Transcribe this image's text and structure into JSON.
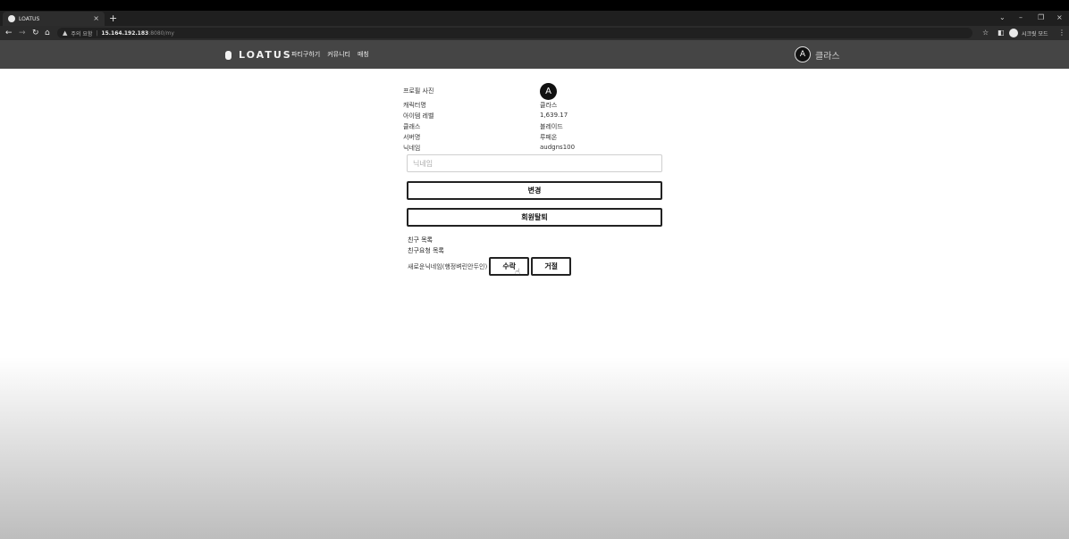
{
  "browser": {
    "tab_title": "LOATUS",
    "tab_close": "×",
    "new_tab": "+",
    "url_warning": "주의 요함",
    "url_host": "15.164.192.183",
    "url_rest": ":8080/my",
    "profile_label": "시크릿 모드",
    "win_minimize": "–",
    "win_restore": "❐",
    "win_close": "×",
    "win_dropdown": "⌄"
  },
  "site": {
    "logo_text": "LOATUS",
    "nav": [
      "파티구하기",
      "커뮤니티",
      "매칭"
    ],
    "header_user_name": "클라스",
    "avatar_glyph": "A"
  },
  "profile": {
    "rows": [
      {
        "label": "프로필 사진"
      },
      {
        "label": "캐릭터명",
        "value": "클라스"
      },
      {
        "label": "아이템 레벨",
        "value": "1,639.17"
      },
      {
        "label": "클래스",
        "value": "블레이드"
      },
      {
        "label": "서버명",
        "value": "루페온"
      },
      {
        "label": "닉네임",
        "value": "audgns100"
      }
    ],
    "nickname_placeholder": "닉네임",
    "change_button": "변경",
    "withdraw_button": "회원탈퇴",
    "friends_label": "친구 목록",
    "friend_requests_label": "친구요청 목록",
    "request_name": "새로운닉네임(행정벼린안두인)",
    "accept_button": "수락",
    "reject_button": "거절"
  }
}
